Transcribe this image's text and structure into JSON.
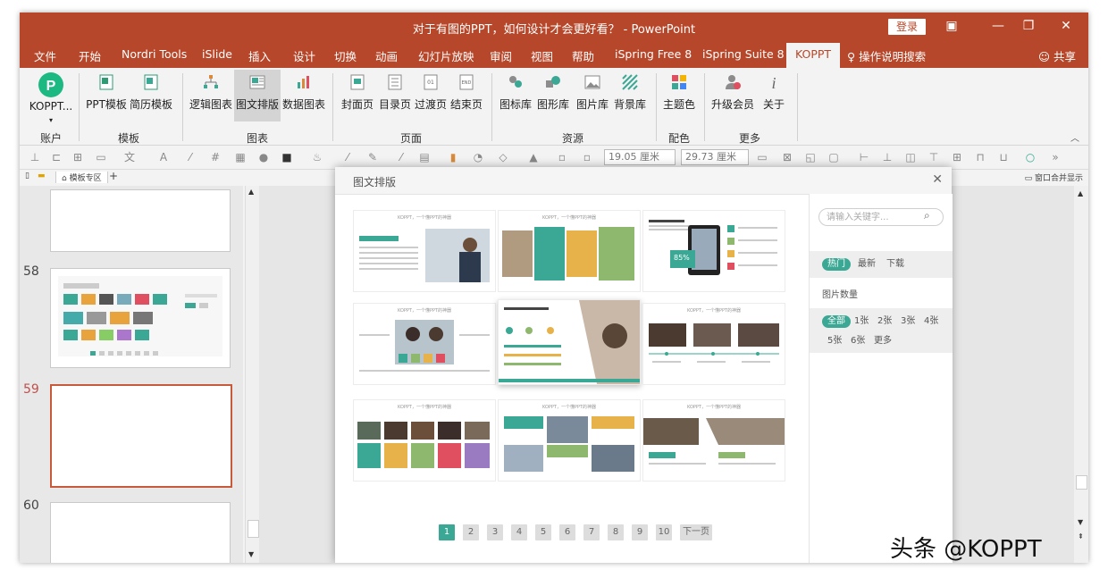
{
  "window": {
    "title": "对于有图的PPT，如何设计才会更好看？ - PowerPoint",
    "login": "登录"
  },
  "tabs": [
    "文件",
    "开始",
    "Nordri Tools",
    "iSlide",
    "插入",
    "设计",
    "切换",
    "动画",
    "幻灯片放映",
    "审阅",
    "视图",
    "帮助",
    "iSpring Free 8",
    "iSpring Suite 8",
    "KOPPT"
  ],
  "active_tab": "KOPPT",
  "tell_me": "操作说明搜索",
  "share": "共享",
  "ribbon": {
    "buttons": [
      "KOPPT...",
      "PPT模板",
      "简历模板",
      "逻辑图表",
      "图文排版",
      "数据图表",
      "封面页",
      "目录页",
      "过渡页",
      "结束页",
      "图标库",
      "图形库",
      "图片库",
      "背景库",
      "主题色",
      "升级会员",
      "关于"
    ],
    "groups": [
      "账户",
      "模板",
      "图表",
      "页面",
      "资源",
      "配色",
      "更多"
    ]
  },
  "quickbar": {
    "width": "19.05 厘米",
    "height": "29.73 厘米"
  },
  "doctabs": {
    "tab": "模板专区",
    "right": "窗口合并显示"
  },
  "slides": [
    "58",
    "59",
    "60"
  ],
  "dialog": {
    "title": "图文排版",
    "card_caption": "KOPPT，一个懂PPT的神器",
    "card_badge": "85%",
    "search_placeholder": "请输入关键字...",
    "sort": [
      "热门",
      "最新",
      "下载"
    ],
    "count_label": "图片数量",
    "counts": [
      "全部",
      "1张",
      "2张",
      "3张",
      "4张",
      "5张",
      "6张",
      "更多"
    ],
    "pages": [
      "1",
      "2",
      "3",
      "4",
      "5",
      "6",
      "7",
      "8",
      "9",
      "10",
      "下一页"
    ]
  },
  "watermark": "头条 @KOPPT",
  "colors": {
    "accent": "#b7472a",
    "teal": "#3aa894"
  }
}
